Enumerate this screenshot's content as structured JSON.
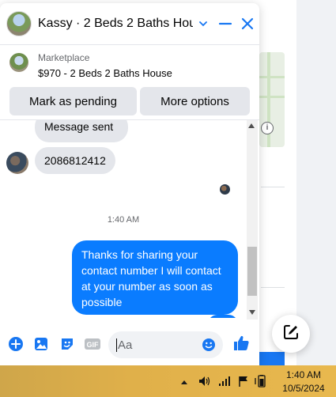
{
  "chat": {
    "title": "Kassy · 2 Beds 2 Baths Hou...",
    "listing": {
      "kicker": "Marketplace",
      "name": "$970 - 2 Beds 2 Baths House"
    },
    "buttons": {
      "mark_pending": "Mark as pending",
      "more_options": "More options"
    },
    "messages": {
      "previous": "Message sent",
      "phone": "2086812412",
      "timestamp": "1:40 AM",
      "outgoing": "Thanks for sharing your contact number I will contact at your number as soon as possible"
    },
    "composer": {
      "placeholder": "Aa"
    }
  },
  "taskbar": {
    "time": "1:40 AM",
    "date": "10/5/2024"
  },
  "icons": {
    "chevron": "chevron-down-icon",
    "minimize": "minimize-icon",
    "close": "close-icon",
    "plus": "plus-circle-icon",
    "photo": "photo-icon",
    "sticker": "sticker-icon",
    "gif": "gif-icon",
    "emoji": "emoji-icon",
    "like": "thumbs-up-icon",
    "compose": "compose-icon"
  },
  "colors": {
    "accent": "#1877f2",
    "outgoing_bubble": "#0a7cff",
    "incoming_bubble": "#e4e6eb"
  }
}
